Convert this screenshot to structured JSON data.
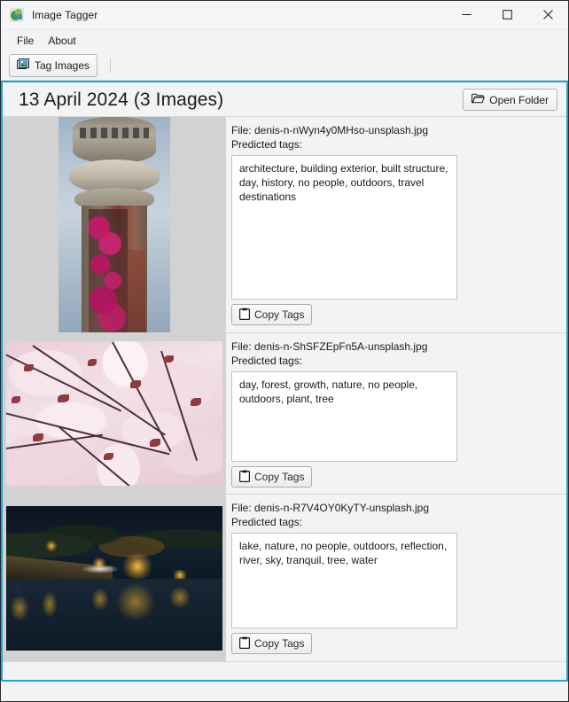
{
  "window": {
    "title": "Image Tagger",
    "icon": "app-logo-icon",
    "controls": {
      "minimize": "minimize-icon",
      "maximize": "maximize-icon",
      "close": "close-icon"
    }
  },
  "menubar": {
    "items": [
      {
        "label": "File"
      },
      {
        "label": "About"
      }
    ]
  },
  "toolbar": {
    "tag_images_label": "Tag Images",
    "tag_images_icon": "stacked-images-icon"
  },
  "content": {
    "accent_color": "#16a7e0",
    "date_header": "13 April 2024 (3 Images)",
    "open_folder_label": "Open Folder",
    "open_folder_icon": "open-folder-icon",
    "file_prefix": "File: ",
    "predicted_label": "Predicted tags:",
    "copy_tags_label": "Copy Tags",
    "copy_tags_icon": "clipboard-icon",
    "rows": [
      {
        "file_line": "File: denis-n-nWyn4y0MHso-unsplash.jpg",
        "predicted_label": "Predicted tags:",
        "tags": "architecture, building exterior, built structure, day, history, no people, outdoors, travel destinations",
        "copy_label": "Copy Tags",
        "thumbnail_alt": "water-tower-with-pink-ivy"
      },
      {
        "file_line": "File: denis-n-ShSFZEpFn5A-unsplash.jpg",
        "predicted_label": "Predicted tags:",
        "tags": "day, forest, growth, nature, no people, outdoors, plant, tree",
        "copy_label": "Copy Tags",
        "thumbnail_alt": "pink-cherry-blossom-branches"
      },
      {
        "file_line": "File: denis-n-R7V4OY0KyTY-unsplash.jpg",
        "predicted_label": "Predicted tags:",
        "tags": "lake, nature, no people, outdoors, reflection, river, sky, tranquil, tree, water",
        "copy_label": "Copy Tags",
        "thumbnail_alt": "night-river-reflection-lights"
      }
    ]
  }
}
